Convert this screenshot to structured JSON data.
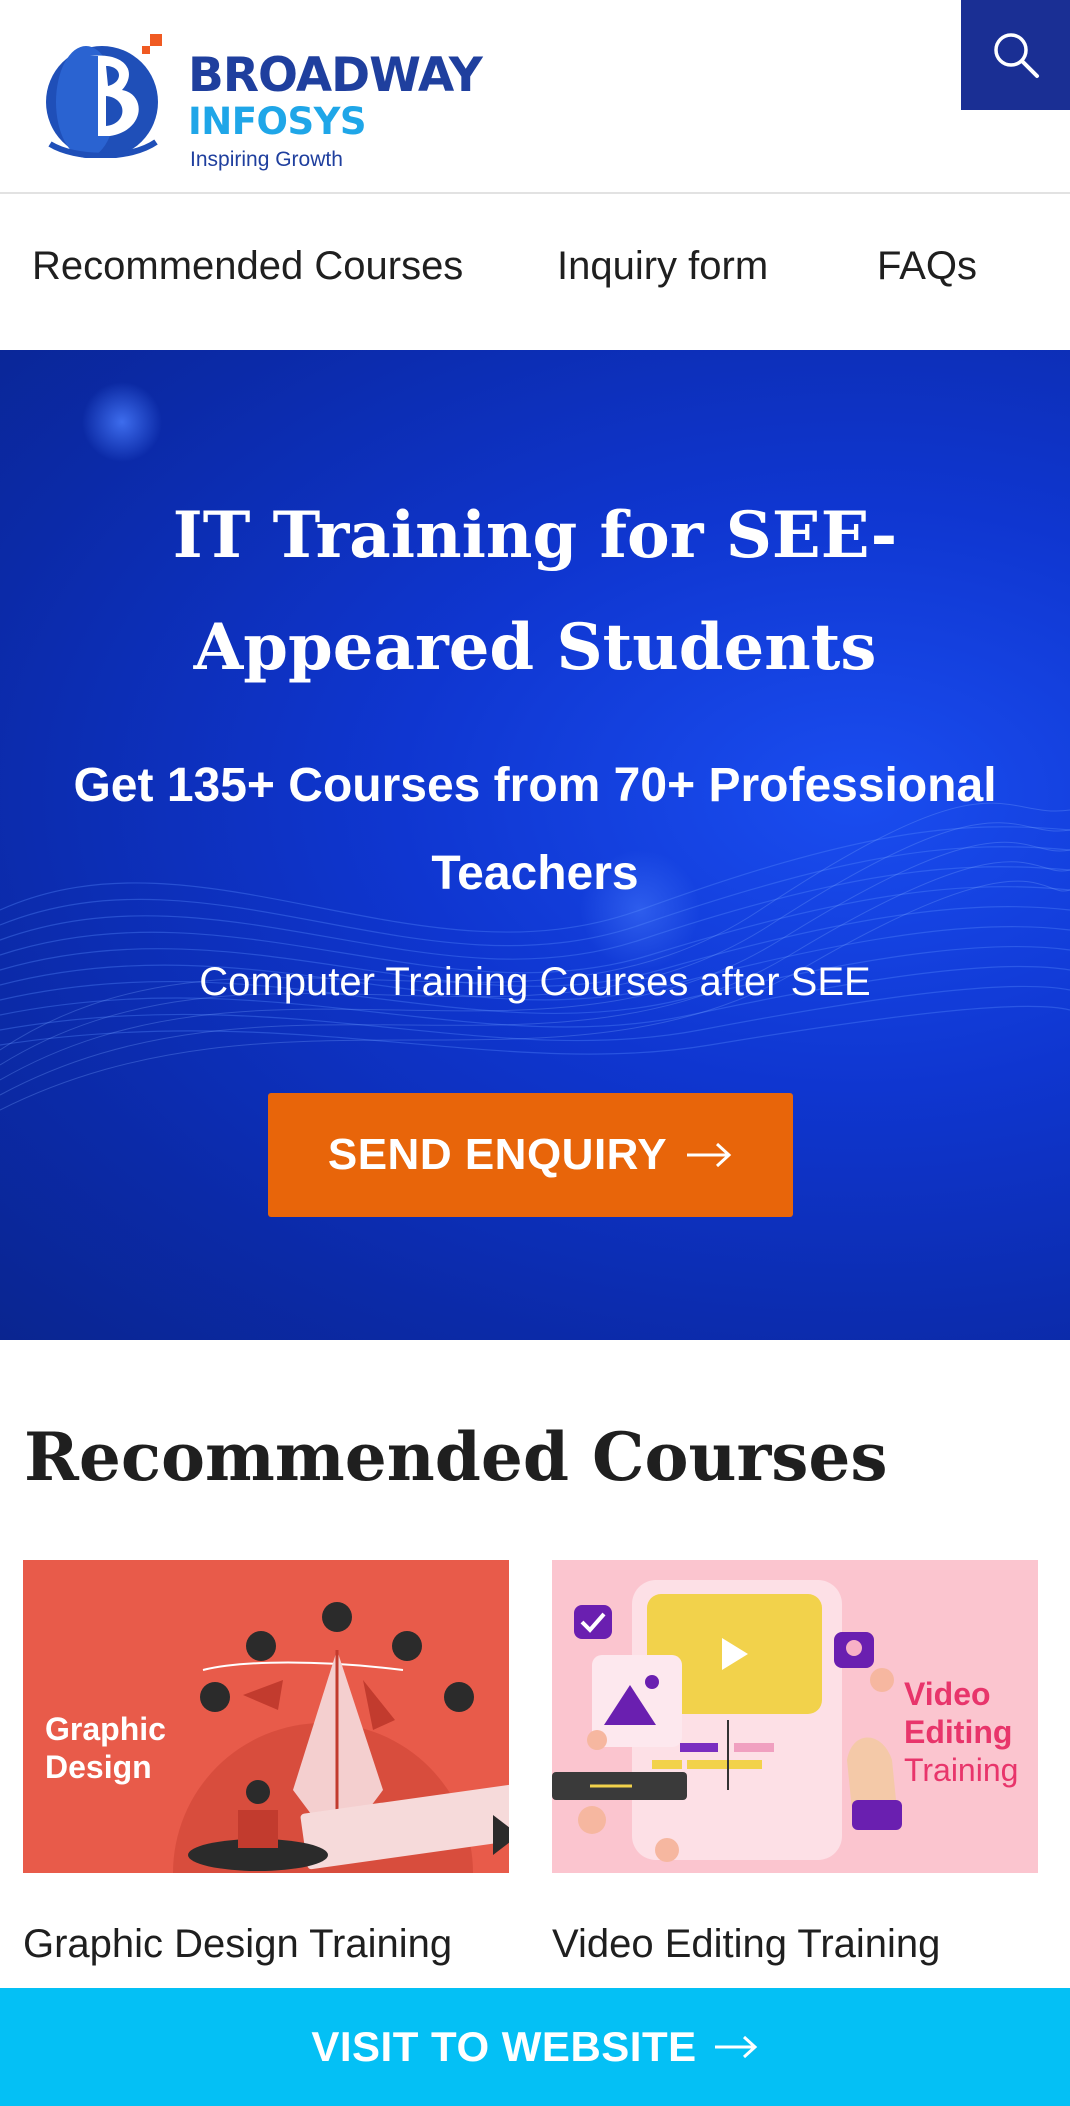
{
  "brand": {
    "name_line1": "BROADWAY",
    "name_line2": "INFOSYS",
    "tagline": "Inspiring Growth"
  },
  "header": {
    "search_icon": "search-icon"
  },
  "nav": {
    "items": [
      {
        "label": "Recommended Courses"
      },
      {
        "label": "Inquiry form"
      },
      {
        "label": "FAQs"
      }
    ]
  },
  "hero": {
    "title": "IT Training for SEE-Appeared Students",
    "subtitle": "Get 135+ Courses from 70+ Professional Teachers",
    "small": "Computer Training Courses after SEE",
    "button_label": "SEND ENQUIRY",
    "button_icon": "arrow-right-icon"
  },
  "recommended": {
    "title": "Recommended Courses",
    "courses": [
      {
        "image_text": "Graphic Design",
        "title": "Graphic Design Training"
      },
      {
        "image_text_1": "Video",
        "image_text_2": "Editing",
        "image_text_3": "Training",
        "title": "Video Editing Training"
      }
    ]
  },
  "footer_bar": {
    "label": "VISIT TO WEBSITE",
    "icon": "arrow-right-icon"
  },
  "colors": {
    "brand_navy": "#1f3f9e",
    "brand_cyan": "#1fa6e8",
    "hero_blue": "#0f36d0",
    "cta_orange": "#e8650a",
    "visit_bar": "#04c0f5"
  }
}
